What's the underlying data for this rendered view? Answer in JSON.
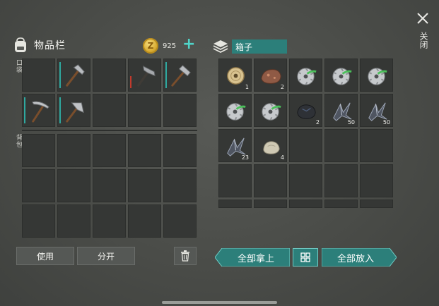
{
  "inventory": {
    "title": "物品栏",
    "pocket_label": "口袋",
    "backpack_label": "背包",
    "coins": "925",
    "coin_symbol": "Z",
    "plus_label": "+"
  },
  "pocket_items": [
    {
      "slot": 1,
      "item": "hammer-icon",
      "equip": "active"
    },
    {
      "slot": 3,
      "item": "hammer-icon",
      "equip": "red"
    },
    {
      "slot": 4,
      "item": "hammer-icon",
      "equip": "active"
    },
    {
      "slot": 5,
      "item": "pickaxe-icon",
      "equip": "active"
    },
    {
      "slot": 6,
      "item": "hammer-icon",
      "equip": "active"
    }
  ],
  "buttons": {
    "use": "使用",
    "split": "分开",
    "take_all": "全部拿上",
    "put_all": "全部放入"
  },
  "box": {
    "title": "箱子",
    "items": [
      {
        "item": "rope-spool-icon",
        "qty": "1"
      },
      {
        "item": "copper-ore-icon",
        "qty": "2"
      },
      {
        "item": "saw-blade-icon",
        "qty": ""
      },
      {
        "item": "saw-blade-icon",
        "qty": ""
      },
      {
        "item": "saw-blade-icon",
        "qty": ""
      },
      {
        "item": "saw-blade-icon",
        "qty": ""
      },
      {
        "item": "saw-blade-icon",
        "qty": ""
      },
      {
        "item": "coal-ore-icon",
        "qty": "2"
      },
      {
        "item": "metal-scrap-icon",
        "qty": "50"
      },
      {
        "item": "metal-scrap-icon",
        "qty": "50"
      },
      {
        "item": "metal-scrap-icon",
        "qty": "23"
      },
      {
        "item": "stone-icon",
        "qty": "4"
      }
    ]
  },
  "close": {
    "label": "关闭"
  },
  "colors": {
    "accent": "#2c7f7a",
    "accent_light": "#4fd4c8",
    "slot_bg": "#353735",
    "equip_red": "#c23a2c"
  }
}
